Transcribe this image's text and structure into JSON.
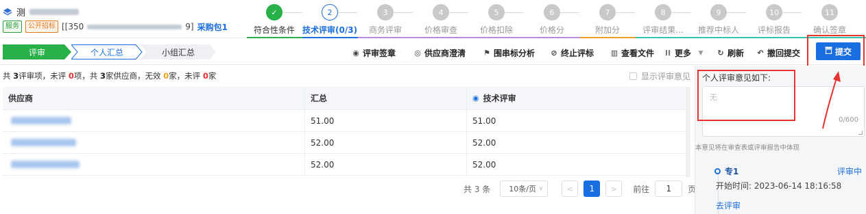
{
  "header": {
    "title_prefix": "测",
    "tag_service": "服务",
    "tag_bid": "公开招标",
    "code_prefix": "[[350",
    "code_suffix": "9]",
    "package": "采购包1"
  },
  "steps": [
    {
      "num": "✓",
      "label": "符合性条件",
      "state": "done"
    },
    {
      "num": "2",
      "label": "技术评审(0/3)",
      "state": "active"
    },
    {
      "num": "3",
      "label": "商务评审",
      "state": "todo"
    },
    {
      "num": "4",
      "label": "价格审查",
      "state": "todo"
    },
    {
      "num": "5",
      "label": "价格扣除",
      "state": "todo"
    },
    {
      "num": "6",
      "label": "价格分",
      "state": "todo"
    },
    {
      "num": "7",
      "label": "附加分",
      "state": "todo"
    },
    {
      "num": "8",
      "label": "评审结果...",
      "state": "todo"
    },
    {
      "num": "9",
      "label": "推荐中标人",
      "state": "todo"
    },
    {
      "num": "10",
      "label": "评标报告",
      "state": "todo"
    },
    {
      "num": "11",
      "label": "确认签章",
      "state": "todo"
    }
  ],
  "toolbar": {
    "crumbs": [
      "评审",
      "个人汇总",
      "小组汇总"
    ],
    "sign": "评审签章",
    "clarify": "供应商澄清",
    "collusion": "围串标分析",
    "terminate": "终止评标",
    "view_files": "查看文件",
    "more": "更多",
    "refresh": "刷新",
    "withdraw": "撤回提交",
    "submit": "提交"
  },
  "summary": {
    "p1": "共 ",
    "items": "3",
    "p2": "评审项，未评 ",
    "unreviewed": "0",
    "p3": "项，共 ",
    "suppliers": "3",
    "p4": "家供应商，无效 ",
    "invalid": "0",
    "p5": "家，未评 ",
    "unrated": "0",
    "p6": "家",
    "show_opinion": "显示评审意见"
  },
  "table": {
    "headers": [
      "供应商",
      "汇总",
      "技术评审"
    ],
    "rows": [
      {
        "total": "51.00",
        "tech": "51.00"
      },
      {
        "total": "52.00",
        "tech": "52.00"
      },
      {
        "total": "52.00",
        "tech": "52.00"
      }
    ]
  },
  "pagination": {
    "total": "共 3 条",
    "page_size": "10条/页",
    "current": "1",
    "goto_label": "前往",
    "goto_value": "1",
    "page_unit": "页"
  },
  "opinion_panel": {
    "title": "个人评审意见如下:",
    "placeholder": "无",
    "count": "0/600",
    "note": "本意见将在审查表或评审报告中体现",
    "expert": "专1",
    "status": "评审中",
    "start_time": "开始时间:  2023-06-14 18:16:58",
    "go_review": "去评审"
  },
  "colors": {
    "accent": "#1a6fe0",
    "success": "#27b148",
    "highlight": "#e8322f"
  }
}
